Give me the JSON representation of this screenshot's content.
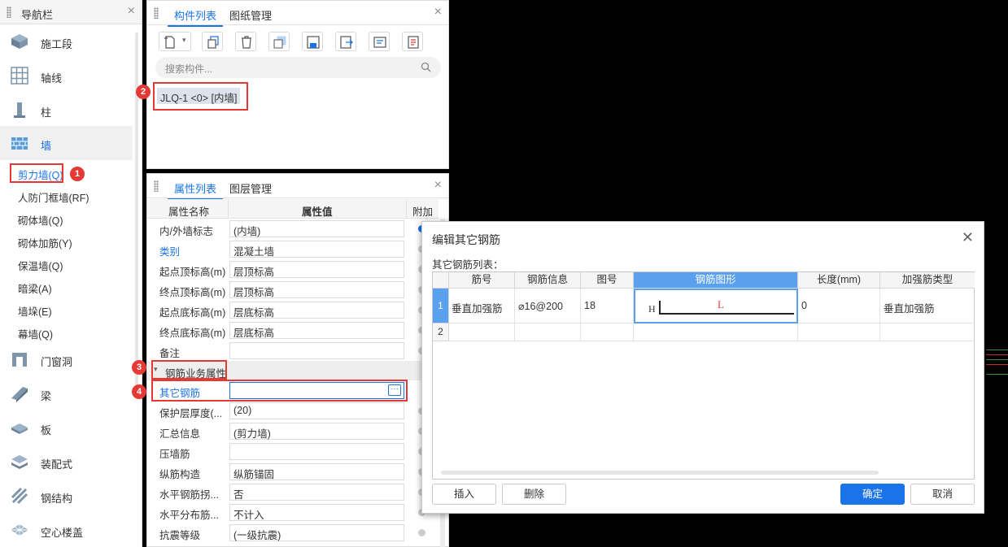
{
  "nav": {
    "title": "导航栏",
    "items": [
      {
        "label": "施工段",
        "icon": "construction-section-icon"
      },
      {
        "label": "轴线",
        "icon": "grid-axis-icon"
      },
      {
        "label": "柱",
        "icon": "column-icon"
      },
      {
        "label": "墙",
        "icon": "wall-icon"
      }
    ],
    "wall_subitems": [
      "剪力墙(Q)",
      "人防门框墙(RF)",
      "砌体墙(Q)",
      "砌体加筋(Y)",
      "保温墙(Q)",
      "暗梁(A)",
      "墙垛(E)",
      "幕墙(Q)"
    ],
    "items_after": [
      {
        "label": "门窗洞",
        "icon": "door-window-icon"
      },
      {
        "label": "梁",
        "icon": "beam-icon"
      },
      {
        "label": "板",
        "icon": "slab-icon"
      },
      {
        "label": "装配式",
        "icon": "prefab-icon"
      },
      {
        "label": "钢结构",
        "icon": "steel-structure-icon"
      },
      {
        "label": "空心楼盖",
        "icon": "hollow-floor-icon"
      }
    ]
  },
  "component_panel": {
    "tabs": [
      "构件列表",
      "图纸管理"
    ],
    "search_placeholder": "搜索构件...",
    "item": "JLQ-1 <0> [内墙]"
  },
  "property_panel": {
    "tabs": [
      "属性列表",
      "图层管理"
    ],
    "headers": [
      "属性名称",
      "属性值",
      "附加"
    ],
    "rows": [
      {
        "name": "内/外墙标志",
        "value": "(内墙)"
      },
      {
        "name": "类别",
        "value": "混凝土墙"
      },
      {
        "name": "起点顶标高(m)",
        "value": "层顶标高"
      },
      {
        "name": "终点顶标高(m)",
        "value": "层顶标高"
      },
      {
        "name": "起点底标高(m)",
        "value": "层底标高"
      },
      {
        "name": "终点底标高(m)",
        "value": "层底标高"
      },
      {
        "name": "备注",
        "value": ""
      }
    ],
    "group": "钢筋业务属性",
    "rows2": [
      {
        "name": "其它钢筋",
        "value": ""
      },
      {
        "name": "保护层厚度(...",
        "value": "(20)"
      },
      {
        "name": "汇总信息",
        "value": "(剪力墙)"
      },
      {
        "name": "压墙筋",
        "value": ""
      },
      {
        "name": "纵筋构造",
        "value": "纵筋锚固"
      },
      {
        "name": "水平钢筋拐...",
        "value": "否"
      },
      {
        "name": "水平分布筋...",
        "value": "不计入"
      },
      {
        "name": "抗震等级",
        "value": "(一级抗震)"
      }
    ]
  },
  "badges": [
    "1",
    "2",
    "3",
    "4"
  ],
  "dialog": {
    "title": "编辑其它钢筋",
    "subtitle": "其它钢筋列表：",
    "columns": [
      "筋号",
      "钢筋信息",
      "图号",
      "钢筋图形",
      "长度(mm)",
      "加强筋类型"
    ],
    "rows": [
      {
        "n": "1",
        "bar": "垂直加强筋",
        "info": "⌀16@200",
        "fig": "18",
        "shape_h": "H",
        "shape_l": "L",
        "length": "0",
        "type": "垂直加强筋"
      },
      {
        "n": "2",
        "bar": "",
        "info": "",
        "fig": "",
        "shape_h": "",
        "shape_l": "",
        "length": "",
        "type": ""
      }
    ],
    "buttons": {
      "insert": "插入",
      "delete": "删除",
      "ok": "确定",
      "cancel": "取消"
    }
  },
  "colors": {
    "accent": "#1a73e8",
    "annotation": "#e53935",
    "selected_header": "#5aa0ee"
  }
}
